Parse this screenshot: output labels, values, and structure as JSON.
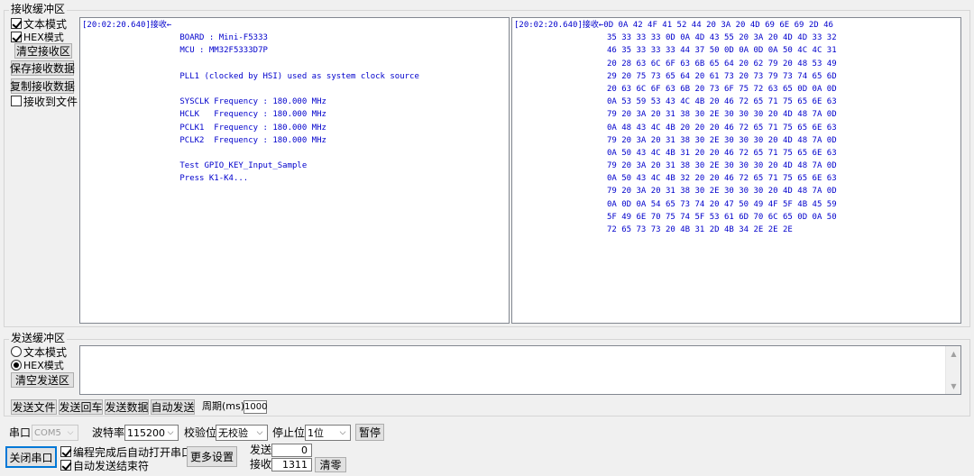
{
  "receive": {
    "group_title": "接收缓冲区",
    "text_mode": "文本模式",
    "hex_mode": "HEX模式",
    "clear_button": "清空接收区",
    "save_button": "保存接收数据",
    "copy_button": "复制接收数据",
    "to_file": "接收到文件",
    "text_lines": [
      "[20:02:20.640]接收←",
      "                    BOARD : Mini-F5333",
      "                    MCU : MM32F5333D7P",
      "",
      "                    PLL1 (clocked by HSI) used as system clock source",
      "",
      "                    SYSCLK Frequency : 180.000 MHz",
      "                    HCLK   Frequency : 180.000 MHz",
      "                    PCLK1  Frequency : 180.000 MHz",
      "                    PCLK2  Frequency : 180.000 MHz",
      "",
      "                    Test GPIO_KEY_Input_Sample",
      "                    Press K1-K4..."
    ],
    "hex_lines": [
      "[20:02:20.640]接收←0D 0A 42 4F 41 52 44 20 3A 20 4D 69 6E 69 2D 46",
      "                   35 33 33 33 0D 0A 4D 43 55 20 3A 20 4D 4D 33 32",
      "                   46 35 33 33 33 44 37 50 0D 0A 0D 0A 50 4C 4C 31",
      "                   20 28 63 6C 6F 63 6B 65 64 20 62 79 20 48 53 49",
      "                   29 20 75 73 65 64 20 61 73 20 73 79 73 74 65 6D",
      "                   20 63 6C 6F 63 6B 20 73 6F 75 72 63 65 0D 0A 0D",
      "                   0A 53 59 53 43 4C 4B 20 46 72 65 71 75 65 6E 63",
      "                   79 20 3A 20 31 38 30 2E 30 30 30 20 4D 48 7A 0D",
      "                   0A 48 43 4C 4B 20 20 20 46 72 65 71 75 65 6E 63",
      "                   79 20 3A 20 31 38 30 2E 30 30 30 20 4D 48 7A 0D",
      "                   0A 50 43 4C 4B 31 20 20 46 72 65 71 75 65 6E 63",
      "                   79 20 3A 20 31 38 30 2E 30 30 30 20 4D 48 7A 0D",
      "                   0A 50 43 4C 4B 32 20 20 46 72 65 71 75 65 6E 63",
      "                   79 20 3A 20 31 38 30 2E 30 30 30 20 4D 48 7A 0D",
      "                   0A 0D 0A 54 65 73 74 20 47 50 49 4F 5F 4B 45 59",
      "                   5F 49 6E 70 75 74 5F 53 61 6D 70 6C 65 0D 0A 50",
      "                   72 65 73 73 20 4B 31 2D 4B 34 2E 2E 2E"
    ]
  },
  "send": {
    "group_title": "发送缓冲区",
    "text_mode": "文本模式",
    "hex_mode": "HEX模式",
    "clear_button": "清空发送区",
    "content": ""
  },
  "toolbar": {
    "send_file": "发送文件",
    "send_enter": "发送回车",
    "send_data": "发送数据",
    "auto_send": "自动发送",
    "period_label": "周期(ms)",
    "period_value": "1000"
  },
  "port": {
    "port_label": "串口",
    "port_value": "COM5",
    "baud_label": "波特率",
    "baud_value": "115200",
    "parity_label": "校验位",
    "parity_value": "无校验",
    "stop_label": "停止位",
    "stop_value": "1位",
    "pause_button": "暂停",
    "close_button": "关闭串口",
    "auto_open": "编程完成后自动打开串口",
    "auto_end": "自动发送结束符",
    "more_settings": "更多设置",
    "sent_label": "发送",
    "sent_count": "0",
    "recv_label": "接收",
    "recv_count": "1311",
    "clear_counts": "清零"
  },
  "icons": {
    "arrow": "chevron-down-icon",
    "scroll_up": "scroll-up-icon",
    "scroll_down": "scroll-down-icon"
  }
}
